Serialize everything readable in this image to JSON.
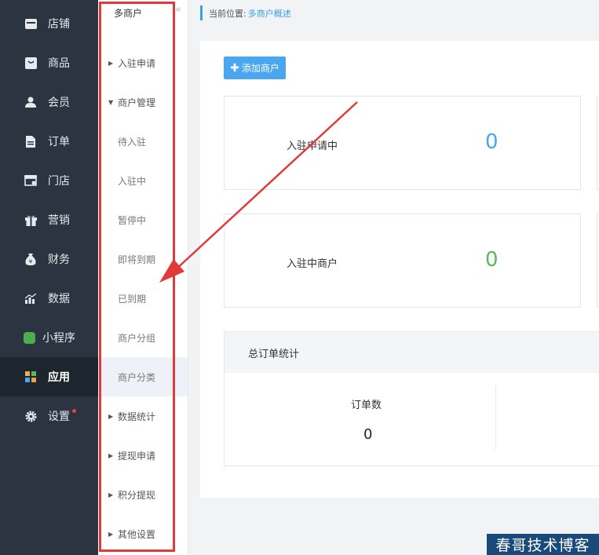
{
  "nav": {
    "items": [
      {
        "label": "店铺",
        "icon": "store-icon"
      },
      {
        "label": "商品",
        "icon": "bag-icon"
      },
      {
        "label": "会员",
        "icon": "user-icon"
      },
      {
        "label": "订单",
        "icon": "order-icon"
      },
      {
        "label": "门店",
        "icon": "shop-icon"
      },
      {
        "label": "营销",
        "icon": "gift-icon"
      },
      {
        "label": "财务",
        "icon": "money-bag-icon"
      },
      {
        "label": "数据",
        "icon": "chart-icon"
      },
      {
        "label": "小程序",
        "icon": "miniprogram-icon"
      },
      {
        "label": "应用",
        "icon": "apps-icon"
      },
      {
        "label": "设置",
        "icon": "gear-icon"
      }
    ],
    "active": "应用"
  },
  "subnav": {
    "title": "多商户",
    "items": [
      {
        "label": "入驻申请"
      },
      {
        "label": "商户管理"
      },
      {
        "label": "待入驻"
      },
      {
        "label": "入驻中"
      },
      {
        "label": "暂停中"
      },
      {
        "label": "即将到期"
      },
      {
        "label": "已到期"
      },
      {
        "label": "商户分组"
      },
      {
        "label": "商户分类"
      },
      {
        "label": "数据统计"
      },
      {
        "label": "提现申请"
      },
      {
        "label": "积分提现"
      },
      {
        "label": "其他设置"
      }
    ]
  },
  "breadcrumb": {
    "prefix": "当前位置:",
    "current": "多商户概述"
  },
  "main": {
    "add_button": "添加商户",
    "cards": [
      {
        "label": "入驻申请中",
        "value": "0",
        "color": "#4aa6ee"
      },
      {
        "label": "入驻中商户",
        "value": "0",
        "color": "#5cb85c"
      }
    ],
    "order_stats": {
      "title": "总订单统计",
      "label": "订单数",
      "value": "0"
    }
  },
  "watermark": "春哥技术博客",
  "colors": {
    "accent": "#4aa6ee",
    "sidebar": "#2b3440",
    "highlight": "#e03a3a"
  }
}
